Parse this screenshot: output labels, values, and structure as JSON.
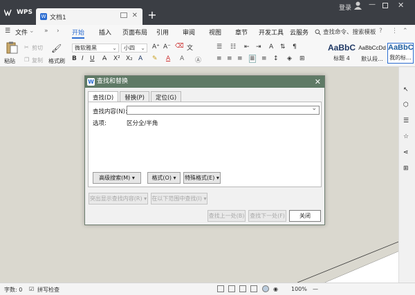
{
  "titlebar": {
    "app_name": "WPS",
    "tab_title": "文档1",
    "login_label": "登录"
  },
  "menubar": {
    "file_label": "文件",
    "more_label": "»",
    "items": [
      "开始",
      "插入",
      "页面布局",
      "引用",
      "审阅",
      "视图",
      "章节",
      "开发工具",
      "云服务"
    ],
    "active_item": "开始",
    "search_placeholder": "查找命令、搜索模板"
  },
  "ribbon": {
    "paste_label": "粘贴",
    "cut_label": "剪切",
    "copy_label": "复制",
    "format_painter_label": "格式刷",
    "font_name": "微软雅黑",
    "font_size": "小四",
    "styles": [
      {
        "preview": "AaBbC",
        "name": "标题 4"
      },
      {
        "preview": "AaBbCcDd",
        "name": "默认段..."
      },
      {
        "preview": "AaBbC",
        "name": "我的标..."
      }
    ]
  },
  "dialog": {
    "title": "查找和替换",
    "tabs": [
      "查找(D)",
      "替换(P)",
      "定位(G)"
    ],
    "active_tab": "查找(D)",
    "find_label": "查找内容(N):",
    "find_value": "",
    "options_label": "选项:",
    "options_value": "区分全/半角",
    "buttons": {
      "advanced": "高级搜索(M)",
      "format": "格式(O)",
      "special": "特殊格式(E)",
      "highlight": "突出显示查找内容(R)",
      "find_in": "在以下范围中查找(I)",
      "find_prev": "查找上一处(B)",
      "find_next": "查找下一处(F)",
      "close": "关闭"
    }
  },
  "statusbar": {
    "word_count": "字数: 0",
    "spell_check": "拼写检查",
    "zoom": "100%"
  },
  "colors": {
    "titlebar": "#3b3e44",
    "accent": "#2b6cd1",
    "dialog_title": "#5f7a66",
    "doc_bg": "#dad8cf"
  }
}
